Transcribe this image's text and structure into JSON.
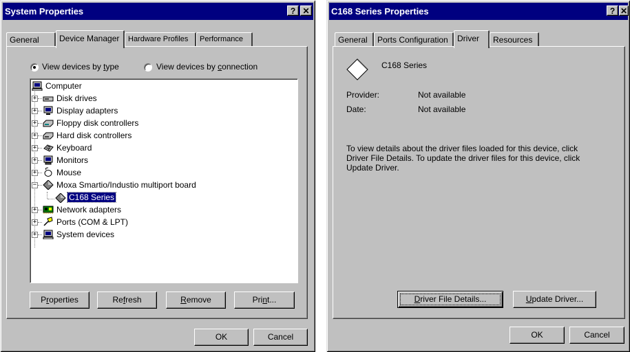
{
  "left_dialog": {
    "title": "System Properties",
    "help_button": "?",
    "close_button": "✕",
    "tabs": [
      {
        "label": "General"
      },
      {
        "label": "Device Manager"
      },
      {
        "label": "Hardware Profiles"
      },
      {
        "label": "Performance"
      }
    ],
    "radio_by_type": {
      "pre": "View devices by ",
      "u": "t",
      "post": "ype"
    },
    "radio_by_connection": {
      "pre": "View devices by ",
      "u": "c",
      "post": "onnection"
    },
    "tree": [
      {
        "label": "Computer",
        "icon": "computer-icon"
      },
      {
        "label": "Disk drives",
        "icon": "disk-drive-icon"
      },
      {
        "label": "Display adapters",
        "icon": "display-adapter-icon"
      },
      {
        "label": "Floppy disk controllers",
        "icon": "floppy-controller-icon"
      },
      {
        "label": "Hard disk controllers",
        "icon": "hard-disk-controller-icon"
      },
      {
        "label": "Keyboard",
        "icon": "keyboard-icon"
      },
      {
        "label": "Monitors",
        "icon": "monitor-icon"
      },
      {
        "label": "Mouse",
        "icon": "mouse-icon"
      },
      {
        "label": "Moxa Smartio/Industio multiport board",
        "icon": "multiport-board-icon"
      },
      {
        "label": "C168 Series",
        "icon": "multiport-device-icon"
      },
      {
        "label": "Network adapters",
        "icon": "network-adapter-icon"
      },
      {
        "label": "Ports (COM & LPT)",
        "icon": "ports-icon"
      },
      {
        "label": "System devices",
        "icon": "system-devices-icon"
      }
    ],
    "expand_glyph": "+",
    "collapse_glyph": "−",
    "buttons": {
      "properties": {
        "pre": "P",
        "u": "r",
        "post": "operties"
      },
      "refresh": {
        "pre": "Re",
        "u": "f",
        "post": "resh"
      },
      "remove": {
        "pre": "",
        "u": "R",
        "post": "emove"
      },
      "print": {
        "pre": "Pri",
        "u": "n",
        "post": "t..."
      },
      "ok": "OK",
      "cancel": "Cancel"
    }
  },
  "right_dialog": {
    "title": "C168 Series Properties",
    "help_button": "?",
    "close_button": "✕",
    "tabs": [
      {
        "label": "General"
      },
      {
        "label": "Ports Configuration"
      },
      {
        "label": "Driver"
      },
      {
        "label": "Resources"
      }
    ],
    "device_name": "C168 Series",
    "provider_label": "Provider:",
    "provider_value": "Not available",
    "date_label": "Date:",
    "date_value": "Not available",
    "description": "To view details about the driver files loaded for this device, click Driver File Details.  To update the driver files for this device, click Update Driver.",
    "buttons": {
      "driver_file_details": {
        "pre": "",
        "u": "D",
        "post": "river File Details..."
      },
      "update_driver": {
        "pre": "",
        "u": "U",
        "post": "pdate Driver..."
      },
      "ok": "OK",
      "cancel": "Cancel"
    }
  },
  "colors": {
    "title_bar": "#000080",
    "face": "#c0c0c0",
    "selection": "#000080"
  }
}
